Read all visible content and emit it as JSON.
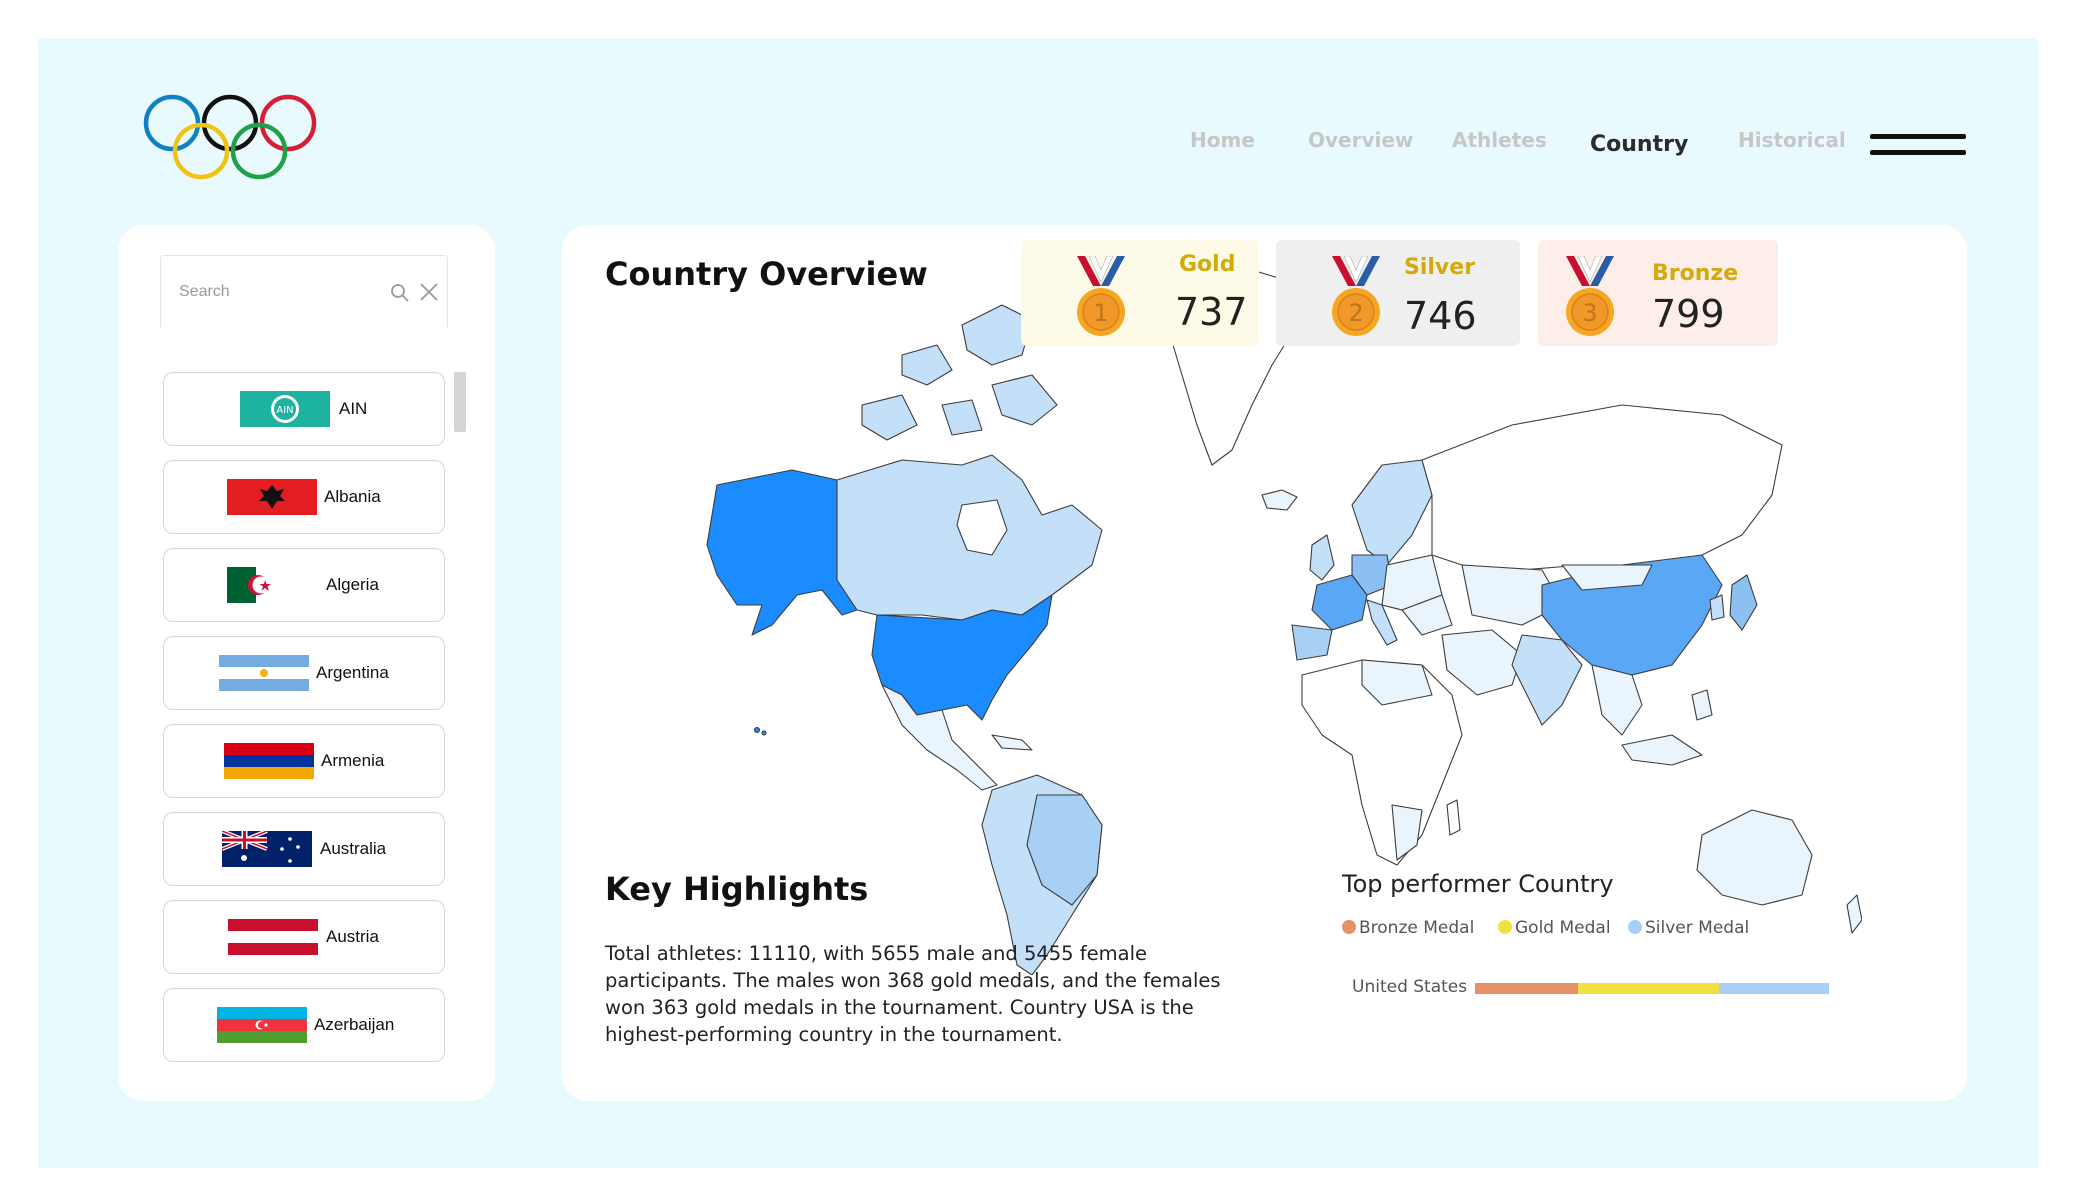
{
  "logo": "olympic-rings-logo",
  "nav": {
    "items": [
      {
        "label": "Home",
        "active": false
      },
      {
        "label": "Overview",
        "active": false
      },
      {
        "label": "Athletes",
        "active": false
      },
      {
        "label": "Country",
        "active": true
      },
      {
        "label": "Historical",
        "active": false
      }
    ],
    "menu_icon": "hamburger-menu-icon"
  },
  "sidebar": {
    "search": {
      "placeholder": "Search",
      "value": ""
    },
    "countries": [
      {
        "name": "AIN",
        "flag": "ain-flag"
      },
      {
        "name": "Albania",
        "flag": "albania-flag"
      },
      {
        "name": "Algeria",
        "flag": "algeria-flag"
      },
      {
        "name": "Argentina",
        "flag": "argentina-flag"
      },
      {
        "name": "Armenia",
        "flag": "armenia-flag"
      },
      {
        "name": "Australia",
        "flag": "australia-flag"
      },
      {
        "name": "Austria",
        "flag": "austria-flag"
      },
      {
        "name": "Azerbaijan",
        "flag": "azerbaijan-flag"
      }
    ]
  },
  "main": {
    "title": "Country Overview",
    "medals": {
      "gold": {
        "label": "Gold",
        "value": "737",
        "rank": "1",
        "color": "#d4aa0b",
        "bg": "#fdfbe7"
      },
      "silver": {
        "label": "Silver",
        "value": "746",
        "rank": "2",
        "color": "#d4aa0b",
        "bg": "#efefef"
      },
      "bronze": {
        "label": "Bronze",
        "value": "799",
        "rank": "3",
        "color": "#d4aa0b",
        "bg": "#fdeeea"
      }
    },
    "key_highlights": {
      "title": "Key Highlights",
      "text": "Total athletes: 11110, with 5655 male and 5455 female participants. The males won 368 gold medals, and the females won 363 gold medals in the tournament. Country USA is the highest-performing country in the tournament."
    },
    "top_performer": {
      "title": "Top performer Country",
      "legend": [
        {
          "label": "Bronze Medal",
          "color": "#e8906a"
        },
        {
          "label": "Gold Medal",
          "color": "#f0e040"
        },
        {
          "label": "Silver Medal",
          "color": "#a8d0f5"
        }
      ],
      "category": "United States",
      "segments": [
        {
          "series": "Bronze Medal",
          "share": 0.22,
          "color": "#e8906a"
        },
        {
          "series": "Gold Medal",
          "share": 0.3,
          "color": "#f0e040"
        },
        {
          "series": "Silver Medal",
          "share": 0.235,
          "color": "#a8d0f5"
        }
      ]
    },
    "map_colors": {
      "highest": "#1a8cff",
      "high": "#5aa8f5",
      "mid": "#8cc0f2",
      "low": "#c4dff8",
      "lowest": "#e9f4fd",
      "stroke": "#3c3c3c"
    }
  }
}
